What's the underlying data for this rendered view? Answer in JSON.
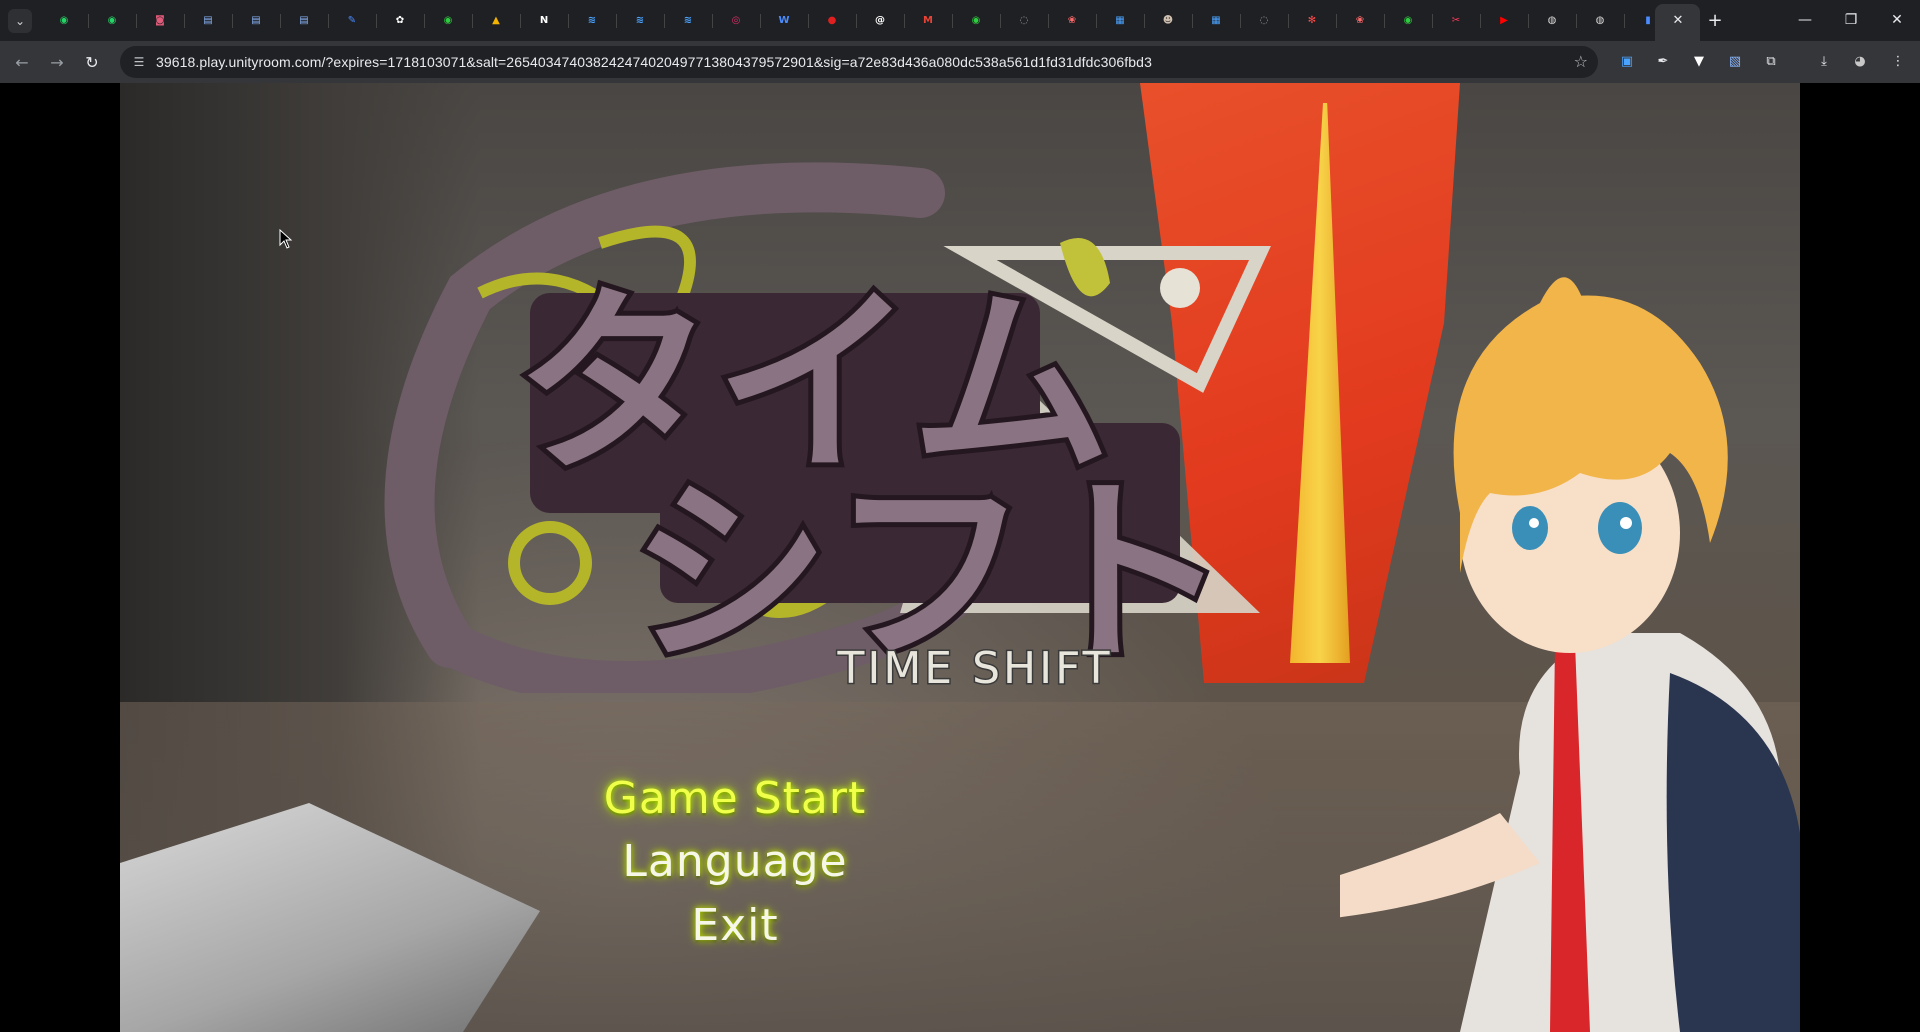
{
  "browser": {
    "tabs": [
      {
        "icon": "whatsapp-icon",
        "glyph": "◉",
        "color": "#25d366"
      },
      {
        "icon": "whatsapp-icon",
        "glyph": "◉",
        "color": "#25d366"
      },
      {
        "icon": "app-icon",
        "glyph": "◙",
        "color": "#e05a7a"
      },
      {
        "icon": "doc-icon",
        "glyph": "▤",
        "color": "#8ab4f8"
      },
      {
        "icon": "doc-icon",
        "glyph": "▤",
        "color": "#8ab4f8"
      },
      {
        "icon": "doc-icon",
        "glyph": "▤",
        "color": "#8ab4f8"
      },
      {
        "icon": "pen-icon",
        "glyph": "✎",
        "color": "#4a8cff"
      },
      {
        "icon": "chatgpt-icon",
        "glyph": "✿",
        "color": "#ffffff"
      },
      {
        "icon": "circle-icon",
        "glyph": "◉",
        "color": "#2ecc40"
      },
      {
        "icon": "drive-icon",
        "glyph": "▲",
        "color": "#f4b400"
      },
      {
        "icon": "notion-icon",
        "glyph": "N",
        "color": "#ffffff"
      },
      {
        "icon": "chart-icon",
        "glyph": "≋",
        "color": "#4aa3ff"
      },
      {
        "icon": "chart-icon",
        "glyph": "≋",
        "color": "#4aa3ff"
      },
      {
        "icon": "chart-icon",
        "glyph": "≋",
        "color": "#4aa3ff"
      },
      {
        "icon": "instagram-icon",
        "glyph": "◎",
        "color": "#e1306c"
      },
      {
        "icon": "w-icon",
        "glyph": "W",
        "color": "#4a8cff"
      },
      {
        "icon": "bookmark-icon",
        "glyph": "●",
        "color": "#e02020"
      },
      {
        "icon": "threads-icon",
        "glyph": "@",
        "color": "#ffffff"
      },
      {
        "icon": "gmail-icon",
        "glyph": "M",
        "color": "#ea4335"
      },
      {
        "icon": "circle-icon",
        "glyph": "◉",
        "color": "#2ecc40"
      },
      {
        "icon": "globe-icon",
        "glyph": "◌",
        "color": "#9aa0a6"
      },
      {
        "icon": "paw-icon",
        "glyph": "❀",
        "color": "#ff6b6b"
      },
      {
        "icon": "grid-icon",
        "glyph": "▦",
        "color": "#4aa3ff"
      },
      {
        "icon": "avatar-icon",
        "glyph": "☻",
        "color": "#d0c0b0"
      },
      {
        "icon": "grid-icon",
        "glyph": "▦",
        "color": "#4aa3ff"
      },
      {
        "icon": "globe-icon",
        "glyph": "◌",
        "color": "#9aa0a6"
      },
      {
        "icon": "settings-icon",
        "glyph": "✻",
        "color": "#ff4a4a"
      },
      {
        "icon": "paw-icon",
        "glyph": "❀",
        "color": "#ff6b6b"
      },
      {
        "icon": "circle-icon",
        "glyph": "◉",
        "color": "#2ecc40"
      },
      {
        "icon": "scissors-icon",
        "glyph": "✂",
        "color": "#ff3b5c"
      },
      {
        "icon": "youtube-icon",
        "glyph": "▶",
        "color": "#ff0000"
      },
      {
        "icon": "chrome-icon",
        "glyph": "◍",
        "color": "#dcdcdc"
      },
      {
        "icon": "chrome-icon",
        "glyph": "◍",
        "color": "#dcdcdc"
      },
      {
        "icon": "book-icon",
        "glyph": "▮",
        "color": "#4a8cff"
      },
      {
        "icon": "unityroom-icon",
        "glyph": "",
        "color": "#35363a"
      }
    ],
    "url": "39618.play.unityroom.com/?expires=1718103071&salt=265403474038242474020497713804379572901&sig=a72e83d436a080dc538a561d1fd31dfdc306fbd3",
    "extensions": [
      {
        "icon": "translate-icon",
        "glyph": "▣",
        "color": "#4aa3ff"
      },
      {
        "icon": "eyedropper-icon",
        "glyph": "✒",
        "color": "#e8eaed"
      },
      {
        "icon": "v-icon",
        "glyph": "▼",
        "color": "#ffffff"
      },
      {
        "icon": "image-icon",
        "glyph": "▧",
        "color": "#8ab4f8"
      },
      {
        "icon": "puzzle-icon",
        "glyph": "⧉",
        "color": "#e8eaed"
      },
      {
        "icon": "download-icon",
        "glyph": "⤓",
        "color": "#e8eaed"
      },
      {
        "icon": "profile-icon",
        "glyph": "◕",
        "color": "#c8c8c8"
      },
      {
        "icon": "menu-icon",
        "glyph": "⋮",
        "color": "#e8eaed"
      }
    ]
  },
  "game": {
    "logo_subtitle": "TIME SHIFT",
    "logo_katakana": "タイムシフト",
    "menu": {
      "start": "Game Start",
      "language": "Language",
      "exit": "Exit"
    }
  }
}
